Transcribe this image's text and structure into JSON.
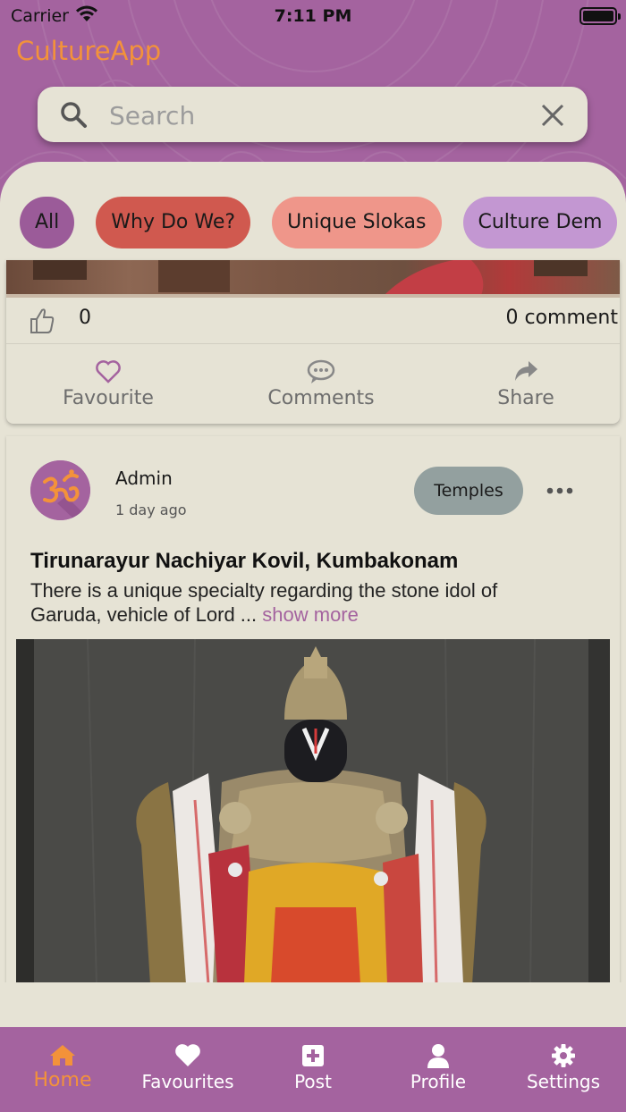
{
  "status_bar": {
    "carrier": "Carrier",
    "time": "7:11 PM"
  },
  "app": {
    "title": "CultureApp"
  },
  "search": {
    "placeholder": "Search",
    "value": ""
  },
  "chips": [
    {
      "label": "All",
      "color": "#9b5b99"
    },
    {
      "label": "Why Do We?",
      "color": "#d0594f"
    },
    {
      "label": "Unique Slokas",
      "color": "#ef968a"
    },
    {
      "label": "Culture Dem",
      "color": "#c397d2"
    }
  ],
  "post_previous": {
    "likes": "0",
    "comments": "0 comment",
    "actions": {
      "favourite": "Favourite",
      "comments": "Comments",
      "share": "Share"
    }
  },
  "post": {
    "author": "Admin",
    "time_ago": "1 day ago",
    "tag": "Temples",
    "title": "Tirunarayur Nachiyar Kovil, Kumbakonam",
    "excerpt": "There is a unique specialty regarding the stone idol of Garuda, vehicle of Lord ...",
    "show_more": "show more"
  },
  "tabbar": {
    "home": "Home",
    "favourites": "Favourites",
    "post": "Post",
    "profile": "Profile",
    "settings": "Settings"
  },
  "colors": {
    "brand_purple": "#a4639f",
    "accent_orange": "#f3923a",
    "surface": "#e6e3d5"
  }
}
